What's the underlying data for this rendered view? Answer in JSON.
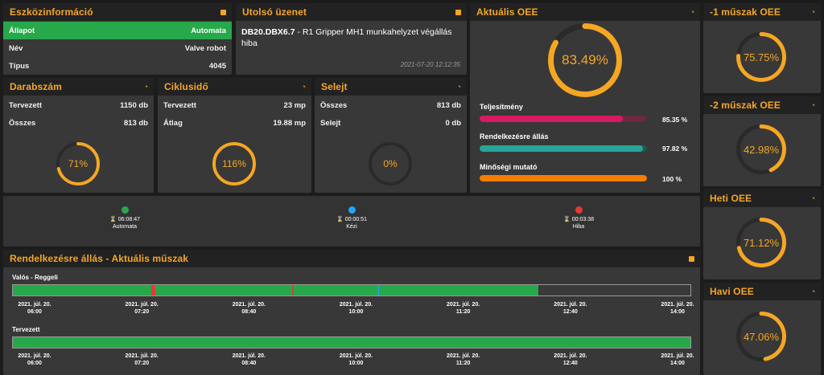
{
  "device_info": {
    "title": "Eszközinformáció",
    "rows": [
      {
        "label": "Állapot",
        "value": "Automata",
        "highlight": true
      },
      {
        "label": "Név",
        "value": "Valve robot",
        "highlight": false
      },
      {
        "label": "Típus",
        "value": "4045",
        "highlight": false
      }
    ]
  },
  "last_message": {
    "title": "Utolsó üzenet",
    "code": "DB20.DBX6.7",
    "text": " - R1 Gripper MH1 munkahelyzet végállás hiba",
    "time": "2021-07-20 12:12:35"
  },
  "current_oee": {
    "title": "Aktuális OEE",
    "value_label": "83.49%",
    "value": 83.49,
    "bars": [
      {
        "label": "Teljesítmény",
        "value": 85.35,
        "value_label": "85.35 %",
        "color": "#d81b60",
        "track": "#6b2a3e"
      },
      {
        "label": "Rendelkezésre állás",
        "value": 97.82,
        "value_label": "97.82 %",
        "color": "#26a69a",
        "track": "#2a5450"
      },
      {
        "label": "Minőségi mutató",
        "value": 100,
        "value_label": "100 %",
        "color": "#f57c00",
        "track": "#6b4a20"
      }
    ]
  },
  "piece_count": {
    "title": "Darabszám",
    "rows": [
      {
        "label": "Tervezett",
        "value": "1150 db"
      },
      {
        "label": "Összes",
        "value": "813 db"
      }
    ],
    "value_label": "71%",
    "value": 71
  },
  "cycle_time": {
    "title": "Ciklusidő",
    "rows": [
      {
        "label": "Tervezett",
        "value": "23 mp"
      },
      {
        "label": "Átlag",
        "value": "19.88 mp"
      }
    ],
    "value_label": "116%",
    "value": 116
  },
  "scrap": {
    "title": "Selejt",
    "rows": [
      {
        "label": "Összes",
        "value": "813 db"
      },
      {
        "label": "Selejt",
        "value": "0 db"
      }
    ],
    "value_label": "0%",
    "value": 0
  },
  "shift_oee": [
    {
      "title": "-1 műszak OEE",
      "value_label": "75.75%",
      "value": 75.75
    },
    {
      "title": "-2 műszak OEE",
      "value_label": "42.98%",
      "value": 42.98
    },
    {
      "title": "Heti OEE",
      "value_label": "71.12%",
      "value": 71.12
    },
    {
      "title": "Havi OEE",
      "value_label": "47.06%",
      "value": 47.06
    }
  ],
  "status_summary": [
    {
      "label": "Automata",
      "time": "06:08:47",
      "color": "#27a84a"
    },
    {
      "label": "Kézi",
      "time": "00:00:51",
      "color": "#1ea7ff"
    },
    {
      "label": "Hiba",
      "time": "00:03:38",
      "color": "#e53935"
    }
  ],
  "availability": {
    "title": "Rendelkezésre állás - Aktuális műszak",
    "actual_label": "Valós - Reggeli",
    "planned_label": "Tervezett",
    "ticks": [
      {
        "date": "2021. júl. 20.",
        "time": "06:00"
      },
      {
        "date": "2021. júl. 20.",
        "time": "07:20"
      },
      {
        "date": "2021. júl. 20.",
        "time": "08:40"
      },
      {
        "date": "2021. júl. 20.",
        "time": "10:00"
      },
      {
        "date": "2021. júl. 20.",
        "time": "11:20"
      },
      {
        "date": "2021. júl. 20.",
        "time": "12:40"
      },
      {
        "date": "2021. júl. 20.",
        "time": "14:00"
      }
    ],
    "actual_segments": [
      {
        "from": 0,
        "to": 0.2045,
        "color": "#27a84a"
      },
      {
        "from": 0.2045,
        "to": 0.2105,
        "color": "#e53935"
      },
      {
        "from": 0.2105,
        "to": 0.4125,
        "color": "#27a84a"
      },
      {
        "from": 0.4125,
        "to": 0.4145,
        "color": "#e53935"
      },
      {
        "from": 0.4145,
        "to": 0.539,
        "color": "#27a84a"
      },
      {
        "from": 0.539,
        "to": 0.5405,
        "color": "#1ea7ff"
      },
      {
        "from": 0.5405,
        "to": 0.776,
        "color": "#27a84a"
      }
    ],
    "planned_segments": [
      {
        "from": 0,
        "to": 1,
        "color": "#27a84a"
      }
    ]
  },
  "colors": {
    "accent": "#f5a623",
    "panel": "#383838",
    "header": "#222222",
    "ring_track": "#2a2a2a"
  }
}
